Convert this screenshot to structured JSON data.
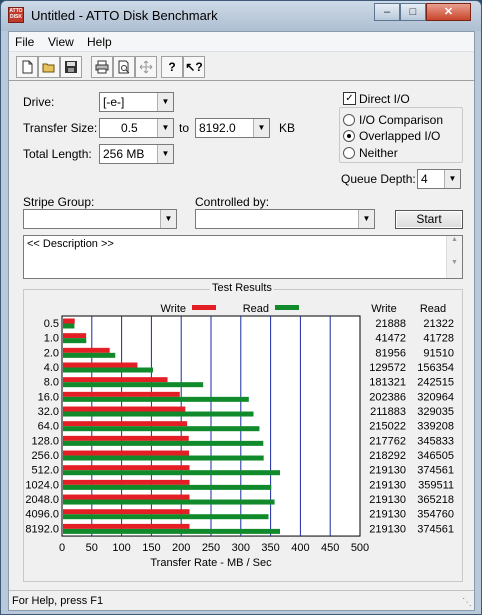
{
  "window": {
    "title": "Untitled - ATTO Disk Benchmark",
    "icon_text": "ATTO DISK"
  },
  "menu": {
    "items": [
      "File",
      "View",
      "Help"
    ]
  },
  "toolbar": {
    "icons": [
      "new-icon",
      "open-icon",
      "save-icon",
      "print-icon",
      "print-preview-icon",
      "move-icon",
      "about-icon",
      "help-pointer-icon"
    ]
  },
  "form": {
    "drive_label": "Drive:",
    "drive_value": "[-e-]",
    "transfer_size_label": "Transfer Size:",
    "transfer_from": "0.5",
    "to_label": "to",
    "transfer_to": "8192.0",
    "kb_label": "KB",
    "total_length_label": "Total Length:",
    "total_length_value": "256 MB",
    "direct_io_label": "Direct I/O",
    "direct_io_checked": true,
    "io_comparison_label": "I/O Comparison",
    "overlapped_io_label": "Overlapped I/O",
    "neither_label": "Neither",
    "selected_mode": "Overlapped I/O",
    "queue_depth_label": "Queue Depth:",
    "queue_depth_value": "4",
    "stripe_group_label": "Stripe Group:",
    "controlled_by_label": "Controlled by:",
    "start_label": "Start",
    "description": "<< Description >>"
  },
  "results": {
    "title": "Test Results",
    "write_legend": "Write",
    "read_legend": "Read",
    "write_col": "Write",
    "read_col": "Read",
    "write_color": "#e31e24",
    "read_color": "#108a2a",
    "grid_color": "#1a2aa0"
  },
  "chart_data": {
    "type": "bar",
    "orientation": "horizontal",
    "categories": [
      "0.5",
      "1.0",
      "2.0",
      "4.0",
      "8.0",
      "16.0",
      "32.0",
      "64.0",
      "128.0",
      "256.0",
      "512.0",
      "1024.0",
      "2048.0",
      "4096.0",
      "8192.0"
    ],
    "series": [
      {
        "name": "Write",
        "values": [
          21888,
          41472,
          81956,
          129572,
          181321,
          202386,
          211883,
          215022,
          217762,
          218292,
          219130,
          219130,
          219130,
          219130,
          219130
        ]
      },
      {
        "name": "Read",
        "values": [
          21322,
          41728,
          91510,
          156354,
          242515,
          320964,
          329035,
          339208,
          345833,
          346505,
          374561,
          359511,
          365218,
          354760,
          374561
        ]
      }
    ],
    "write_labels": [
      "21888",
      "41472",
      "81956",
      "129572",
      "181321",
      "202386",
      "211883",
      "215022",
      "217762",
      "218292",
      "219130",
      "219130",
      "219130",
      "219130",
      "219130"
    ],
    "read_labels": [
      "21322",
      "41728",
      "91510",
      "156354",
      "242515",
      "320964",
      "329035",
      "339208",
      "345833",
      "346505",
      "374561",
      "359511",
      "365218",
      "354760",
      "374561"
    ],
    "xlabel": "Transfer Rate - MB / Sec",
    "xticks": [
      "0",
      "50",
      "100",
      "150",
      "200",
      "250",
      "300",
      "350",
      "400",
      "450",
      "500"
    ],
    "xlim": [
      0,
      500
    ],
    "legend": "top"
  },
  "status": {
    "text": "For Help, press F1"
  }
}
